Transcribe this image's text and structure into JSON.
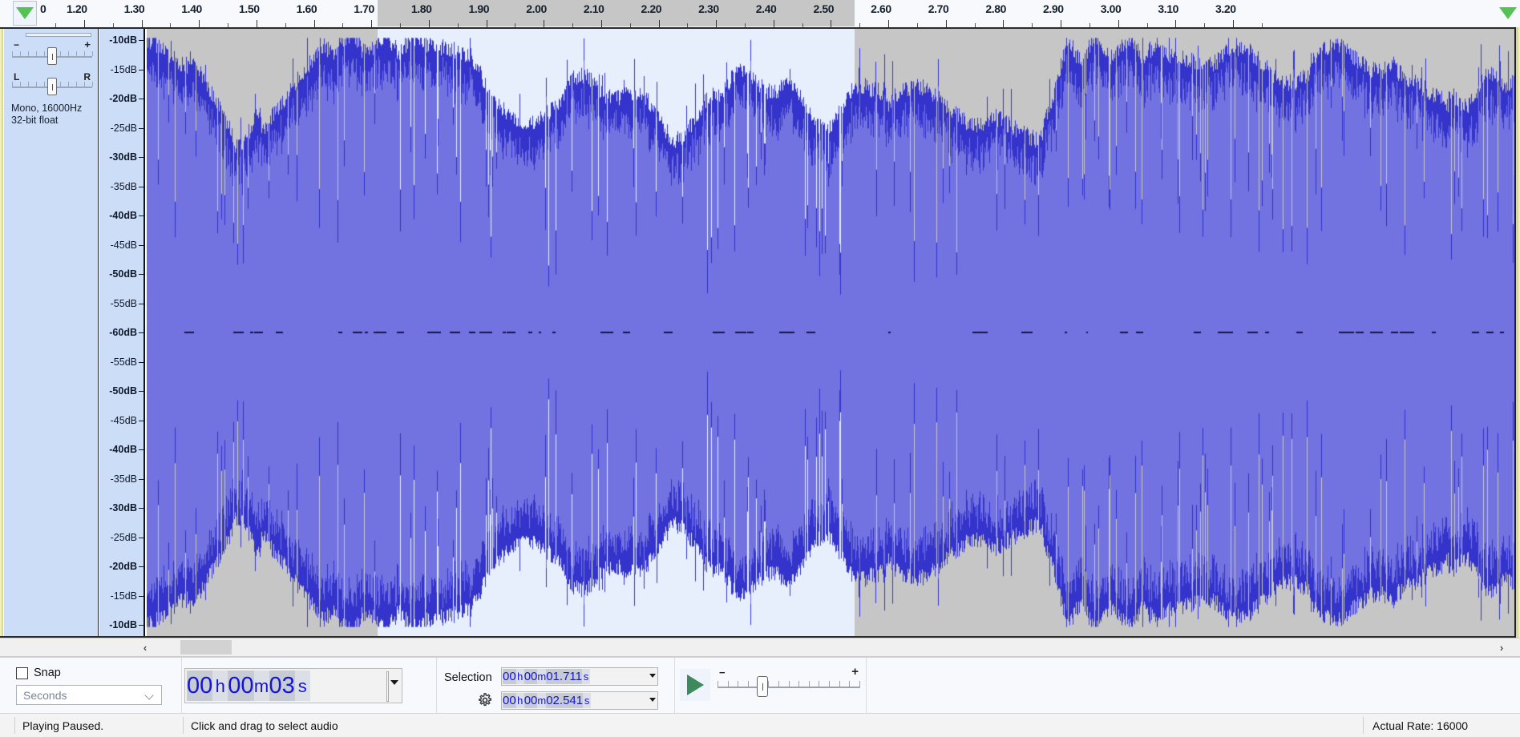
{
  "app": "Audacity",
  "ruler": {
    "labels": [
      "0",
      "1.20",
      "1.30",
      "1.40",
      "1.50",
      "1.60",
      "1.70",
      "1.80",
      "1.90",
      "2.00",
      "2.10",
      "2.20",
      "2.30",
      "2.40",
      "2.50",
      "2.60",
      "2.70",
      "2.80",
      "2.90",
      "3.00",
      "3.10",
      "3.20"
    ],
    "unit": "seconds",
    "pin_left_icon": "play-pinned-triangle-icon",
    "pin_right_icon": "play-pinned-triangle-icon",
    "selection_start_label": "1.70",
    "selection_end_label": "2.50"
  },
  "track": {
    "gain_slider": {
      "min_label": "−",
      "max_label": "+",
      "name": "gain"
    },
    "pan_slider": {
      "min_label": "L",
      "max_label": "R",
      "name": "pan"
    },
    "info_line1": "Mono, 16000Hz",
    "info_line2": "32-bit float",
    "vertical_ruler_labels": [
      "-10dB",
      "-15dB",
      "-20dB",
      "-25dB",
      "-30dB",
      "-35dB",
      "-40dB",
      "-45dB",
      "-50dB",
      "-55dB",
      "-60dB",
      "-55dB",
      "-50dB",
      "-45dB",
      "-40dB",
      "-35dB",
      "-30dB",
      "-25dB",
      "-20dB",
      "-15dB",
      "-10dB"
    ],
    "waveform_colors": {
      "peak": "#3434cc",
      "rms": "#7272e0",
      "background_unselected": "#c6c6c6",
      "background_selected": "#e7eefc",
      "center_line": "#1b1b4f"
    }
  },
  "scrollbar": {
    "left_arrow": "‹",
    "right_arrow": "›"
  },
  "toolbar": {
    "snap_label": "Snap",
    "snap_checked": false,
    "snap_units_value": "Seconds",
    "time_display": {
      "hh": "00",
      "h_unit": "h",
      "mm": "00",
      "m_unit": "m",
      "ss": "03",
      "s_unit": "s"
    },
    "selection_label": "Selection",
    "selection_start": {
      "hh": "00",
      "h_unit": "h",
      "mm": "00",
      "m_unit": "m",
      "ss": "01.711",
      "s_unit": "s"
    },
    "selection_end": {
      "hh": "00",
      "h_unit": "h",
      "mm": "00",
      "m_unit": "m",
      "ss": "02.541",
      "s_unit": "s"
    },
    "play_button": "play",
    "speed_min": "−",
    "speed_max": "+"
  },
  "status": {
    "left": "Playing Paused.",
    "center": "Click and drag to select audio",
    "right": "Actual Rate: 16000"
  }
}
